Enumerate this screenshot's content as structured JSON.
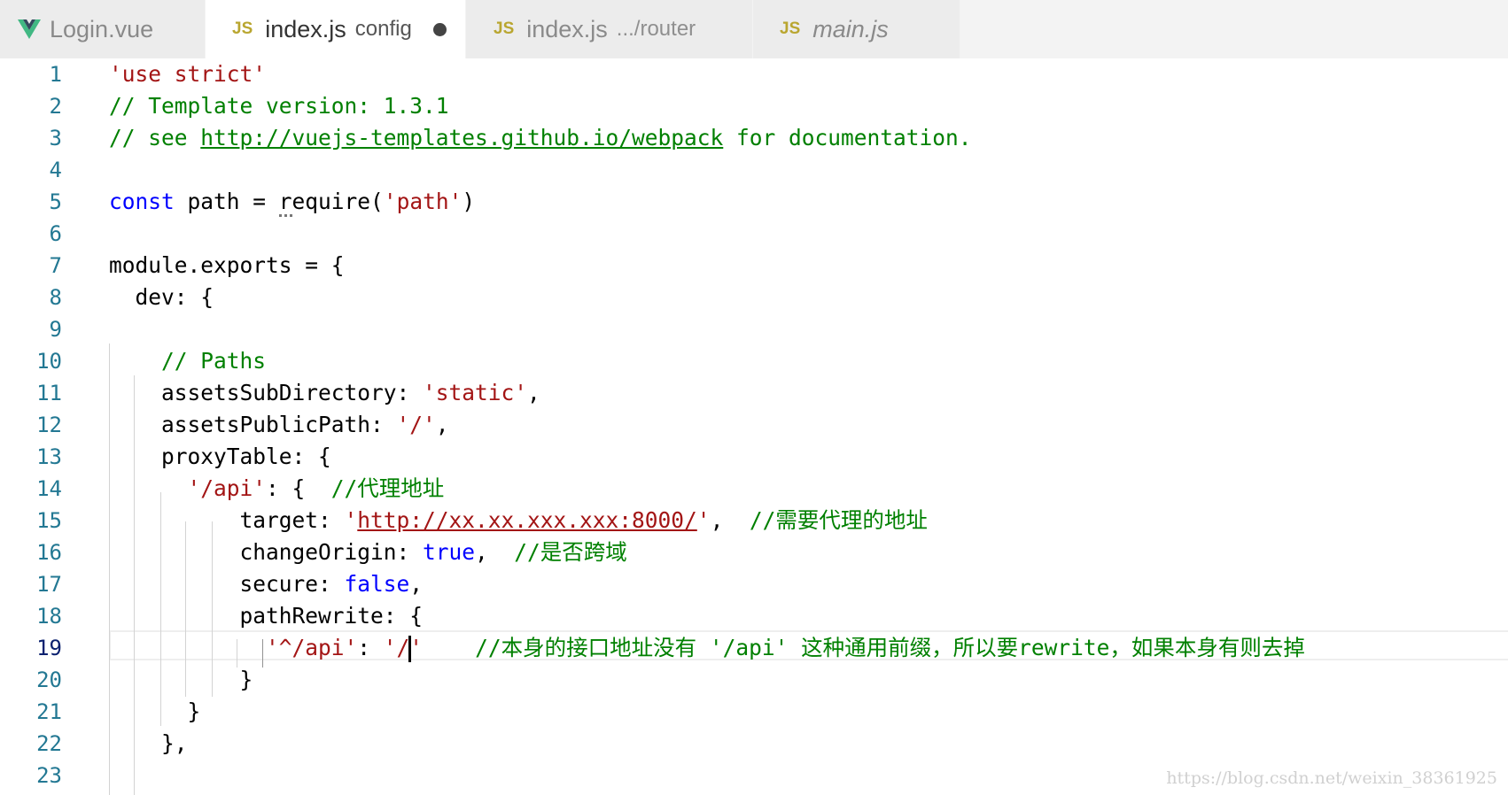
{
  "tabs": [
    {
      "icon": "V",
      "name": "Login.vue",
      "desc": "",
      "active": false,
      "dirty": false
    },
    {
      "icon": "JS",
      "name": "index.js",
      "desc": "config",
      "active": true,
      "dirty": true
    },
    {
      "icon": "JS",
      "name": "index.js",
      "desc": ".../router",
      "active": false,
      "dirty": false
    },
    {
      "icon": "JS",
      "name": "main.js",
      "desc": "",
      "active": false,
      "dirty": false
    }
  ],
  "lines": [
    {
      "n": "1",
      "t": [
        [
          "str",
          "'use strict'"
        ]
      ]
    },
    {
      "n": "2",
      "t": [
        [
          "cm",
          "// Template version: 1.3.1"
        ]
      ]
    },
    {
      "n": "3",
      "t": [
        [
          "cm",
          "// see "
        ],
        [
          "cm link",
          "http://vuejs-templates.github.io/webpack"
        ],
        [
          "cm",
          " for documentation."
        ]
      ]
    },
    {
      "n": "4",
      "t": []
    },
    {
      "n": "5",
      "t": [
        [
          "kw",
          "const"
        ],
        [
          "",
          " path = "
        ],
        [
          "squiggle",
          "r"
        ],
        [
          "",
          "equire("
        ],
        [
          "str",
          "'path'"
        ],
        [
          "",
          ")"
        ]
      ]
    },
    {
      "n": "6",
      "t": []
    },
    {
      "n": "7",
      "t": [
        [
          "",
          "module.exports = {"
        ]
      ]
    },
    {
      "n": "8",
      "t": [
        [
          "",
          "  dev: {"
        ]
      ]
    },
    {
      "n": "9",
      "t": []
    },
    {
      "n": "10",
      "t": [
        [
          "cm",
          "    // Paths"
        ]
      ]
    },
    {
      "n": "11",
      "t": [
        [
          "",
          "    assetsSubDirectory: "
        ],
        [
          "str",
          "'static'"
        ],
        [
          "",
          ","
        ]
      ]
    },
    {
      "n": "12",
      "t": [
        [
          "",
          "    assetsPublicPath: "
        ],
        [
          "str",
          "'/'"
        ],
        [
          "",
          ","
        ]
      ]
    },
    {
      "n": "13",
      "t": [
        [
          "",
          "    proxyTable: {"
        ]
      ]
    },
    {
      "n": "14",
      "t": [
        [
          "str",
          "      '/api'"
        ],
        [
          "",
          ": {  "
        ],
        [
          "cm",
          "//代理地址"
        ]
      ]
    },
    {
      "n": "15",
      "t": [
        [
          "",
          "          target: "
        ],
        [
          "str",
          "'"
        ],
        [
          "str link",
          "http://xx.xx.xxx.xxx:8000/"
        ],
        [
          "str",
          "'"
        ],
        [
          "",
          ",  "
        ],
        [
          "cm",
          "//需要代理的地址"
        ]
      ]
    },
    {
      "n": "16",
      "t": [
        [
          "",
          "          changeOrigin: "
        ],
        [
          "kw",
          "true"
        ],
        [
          "",
          ",  "
        ],
        [
          "cm",
          "//是否跨域"
        ]
      ]
    },
    {
      "n": "17",
      "t": [
        [
          "",
          "          secure: "
        ],
        [
          "kw",
          "false"
        ],
        [
          "",
          ","
        ]
      ]
    },
    {
      "n": "18",
      "t": [
        [
          "",
          "          pathRewrite: {"
        ]
      ]
    },
    {
      "n": "19",
      "t": [
        [
          "str",
          "            '^/api'"
        ],
        [
          "",
          ": "
        ],
        [
          "str",
          "'/"
        ],
        [
          "cursor",
          ""
        ],
        [
          "str",
          "'"
        ],
        [
          "",
          "    "
        ],
        [
          "cm",
          "//本身的接口地址没有 '/api' 这种通用前缀，所以要rewrite，如果本身有则去掉"
        ]
      ],
      "current": true
    },
    {
      "n": "20",
      "t": [
        [
          "",
          "          }"
        ]
      ]
    },
    {
      "n": "21",
      "t": [
        [
          "",
          "      }"
        ]
      ]
    },
    {
      "n": "22",
      "t": [
        [
          "",
          "    },"
        ]
      ]
    },
    {
      "n": "23",
      "t": []
    }
  ],
  "watermark": "https://blog.csdn.net/weixin_38361925"
}
